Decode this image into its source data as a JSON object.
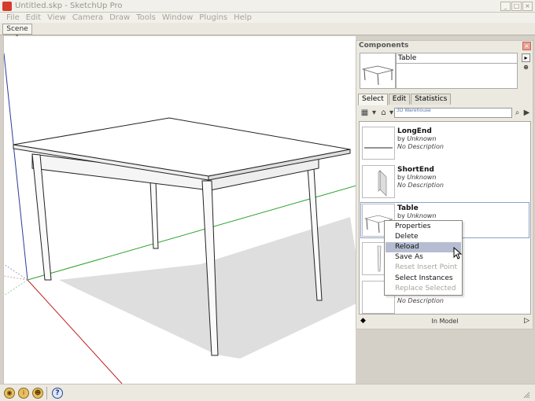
{
  "window": {
    "title": "Untitled.skp - SketchUp Pro"
  },
  "menu": [
    "File",
    "Edit",
    "View",
    "Camera",
    "Draw",
    "Tools",
    "Window",
    "Plugins",
    "Help"
  ],
  "scenes": [
    "Scene 1"
  ],
  "components_panel": {
    "title": "Components",
    "name_value": "Table",
    "tabs": [
      "Select",
      "Edit",
      "Statistics"
    ],
    "search_placeholder": "3D Warehouse",
    "items": [
      {
        "name": "LongEnd",
        "by_prefix": "by",
        "author": "Unknown",
        "description": "No Description"
      },
      {
        "name": "ShortEnd",
        "by_prefix": "by",
        "author": "Unknown",
        "description": "No Description"
      },
      {
        "name": "Table",
        "by_prefix": "by",
        "author": "Unknown",
        "description": "No Description"
      },
      {
        "name": "",
        "by_prefix": "",
        "author": "",
        "description": ""
      },
      {
        "name": "",
        "by_prefix": "",
        "author": "",
        "description": "No Description"
      }
    ],
    "footer": "In Model"
  },
  "context_menu": {
    "items": [
      {
        "label": "Properties",
        "enabled": true
      },
      {
        "label": "Delete",
        "enabled": true
      },
      {
        "label": "Reload",
        "enabled": true,
        "hover": true
      },
      {
        "label": "Save As",
        "enabled": true
      },
      {
        "label": "Reset Insert Point",
        "enabled": false
      },
      {
        "label": "Select Instances",
        "enabled": true
      },
      {
        "label": "Replace Selected",
        "enabled": false
      }
    ]
  },
  "status_icons": [
    "geo-location-icon",
    "credits-icon",
    "user-icon",
    "help-icon"
  ]
}
